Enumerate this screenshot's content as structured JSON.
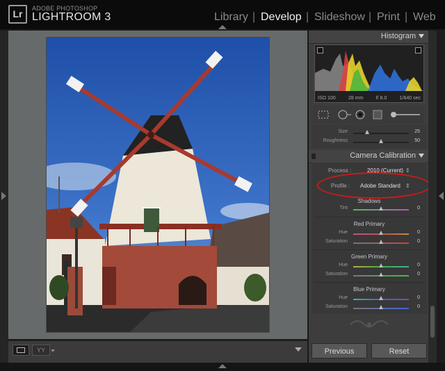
{
  "brand": {
    "logo": "Lr",
    "top": "ADOBE PHOTOSHOP",
    "main": "LIGHTROOM 3"
  },
  "modules": [
    {
      "label": "Library",
      "active": false
    },
    {
      "label": "Develop",
      "active": true
    },
    {
      "label": "Slideshow",
      "active": false
    },
    {
      "label": "Print",
      "active": false
    },
    {
      "label": "Web",
      "active": false
    }
  ],
  "module_separator": "|",
  "histogram": {
    "title": "Histogram",
    "iso": "ISO 100",
    "focal": "28 mm",
    "aperture": "f/ 8.0",
    "shutter": "1/640 sec"
  },
  "tools": [
    "crop-icon",
    "spot-removal-icon",
    "red-eye-icon",
    "graduated-filter-icon",
    "adjustment-brush-icon"
  ],
  "detail_sliders": [
    {
      "label": "Size",
      "value": "25",
      "pos": 0.2
    },
    {
      "label": "Roughness",
      "value": "50",
      "pos": 0.5
    }
  ],
  "calibration": {
    "title": "Camera Calibration",
    "process_label": "Process :",
    "process_value": "2010 (Current)",
    "profile_label": "Profile :",
    "profile_value": "Adobe Standard",
    "sections": [
      {
        "title": "Shadows",
        "sliders": [
          {
            "label": "Tint",
            "value": "0"
          }
        ]
      },
      {
        "title": "Red Primary",
        "sliders": [
          {
            "label": "Hue",
            "value": "0"
          },
          {
            "label": "Saturation",
            "value": "0"
          }
        ]
      },
      {
        "title": "Green Primary",
        "sliders": [
          {
            "label": "Hue",
            "value": "0"
          },
          {
            "label": "Saturation",
            "value": "0"
          }
        ]
      },
      {
        "title": "Blue Primary",
        "sliders": [
          {
            "label": "Hue",
            "value": "0"
          },
          {
            "label": "Saturation",
            "value": "0"
          }
        ]
      }
    ]
  },
  "buttons": {
    "previous": "Previous",
    "reset": "Reset"
  },
  "toolbar": {
    "view_icons": [
      "loupe-view-icon",
      "before-after-icon"
    ]
  },
  "colors": {
    "accent_annotation": "#d61818",
    "active_tab": "#f0f0f0",
    "inactive_tab": "#8a8a8a"
  }
}
